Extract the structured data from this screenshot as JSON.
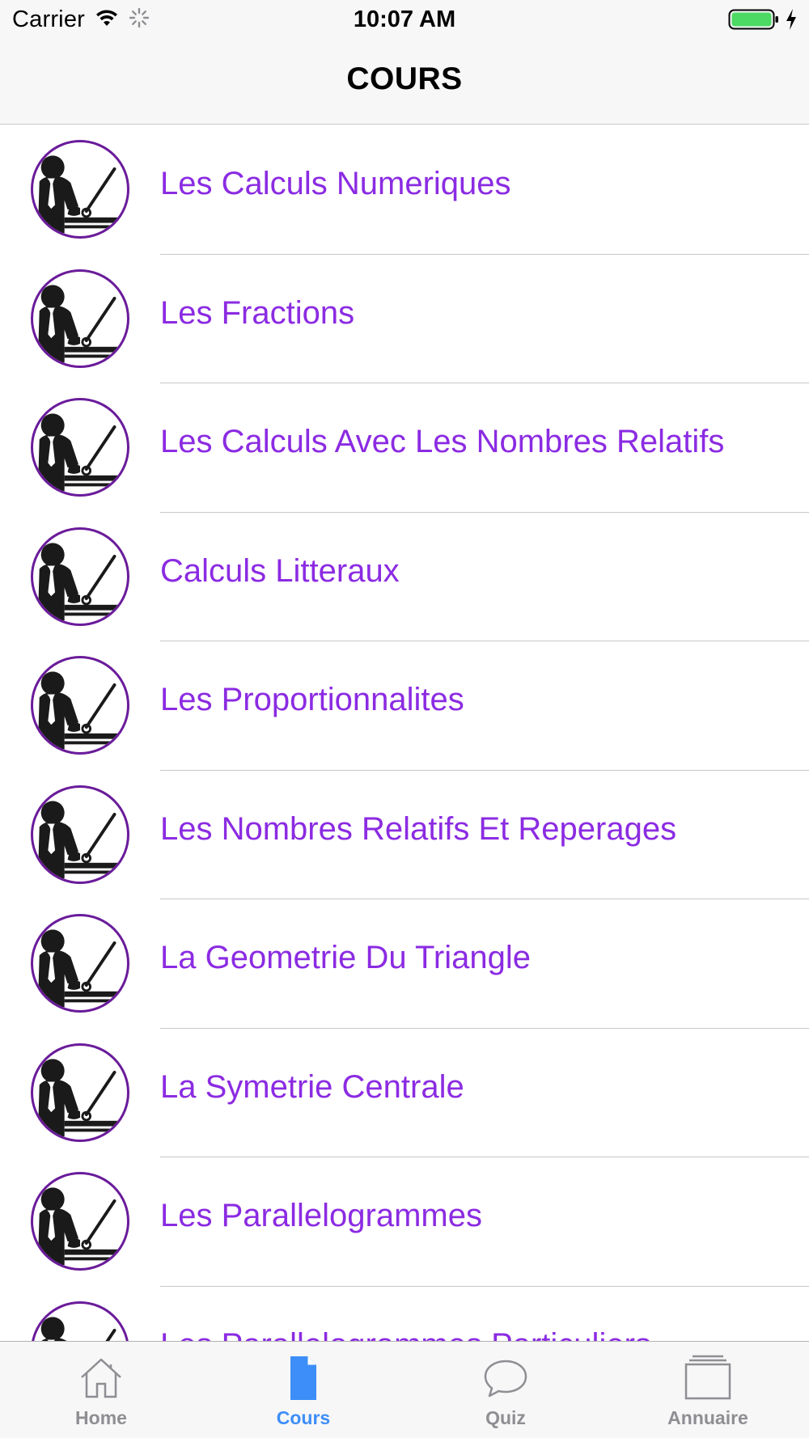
{
  "status_bar": {
    "carrier": "Carrier",
    "time": "10:07 AM",
    "battery_color": "#4cd964"
  },
  "nav": {
    "title": "COURS"
  },
  "courses": [
    {
      "label": "Les Calculs Numeriques",
      "icon": "teacher-icon"
    },
    {
      "label": "Les Fractions",
      "icon": "teacher-icon"
    },
    {
      "label": "Les Calculs Avec Les Nombres Relatifs",
      "icon": "teacher-icon"
    },
    {
      "label": "Calculs Litteraux",
      "icon": "teacher-icon"
    },
    {
      "label": "Les Proportionnalites",
      "icon": "teacher-icon"
    },
    {
      "label": "Les Nombres Relatifs Et Reperages",
      "icon": "teacher-icon"
    },
    {
      "label": "La Geometrie Du Triangle",
      "icon": "teacher-icon"
    },
    {
      "label": "La Symetrie Centrale",
      "icon": "teacher-icon"
    },
    {
      "label": "Les Parallelogrammes",
      "icon": "teacher-icon"
    },
    {
      "label": "Les Parallelogrammes Particuliers",
      "icon": "teacher-icon"
    }
  ],
  "tabs": [
    {
      "label": "Home",
      "icon": "home-icon",
      "active": false
    },
    {
      "label": "Cours",
      "icon": "document-icon",
      "active": true
    },
    {
      "label": "Quiz",
      "icon": "chat-bubble-icon",
      "active": false
    },
    {
      "label": "Annuaire",
      "icon": "folder-stack-icon",
      "active": false
    }
  ],
  "colors": {
    "accent_purple": "#8b2be2",
    "avatar_ring": "#6a1b9a",
    "tab_active": "#3d8ef8",
    "tab_inactive": "#8e8e93"
  }
}
